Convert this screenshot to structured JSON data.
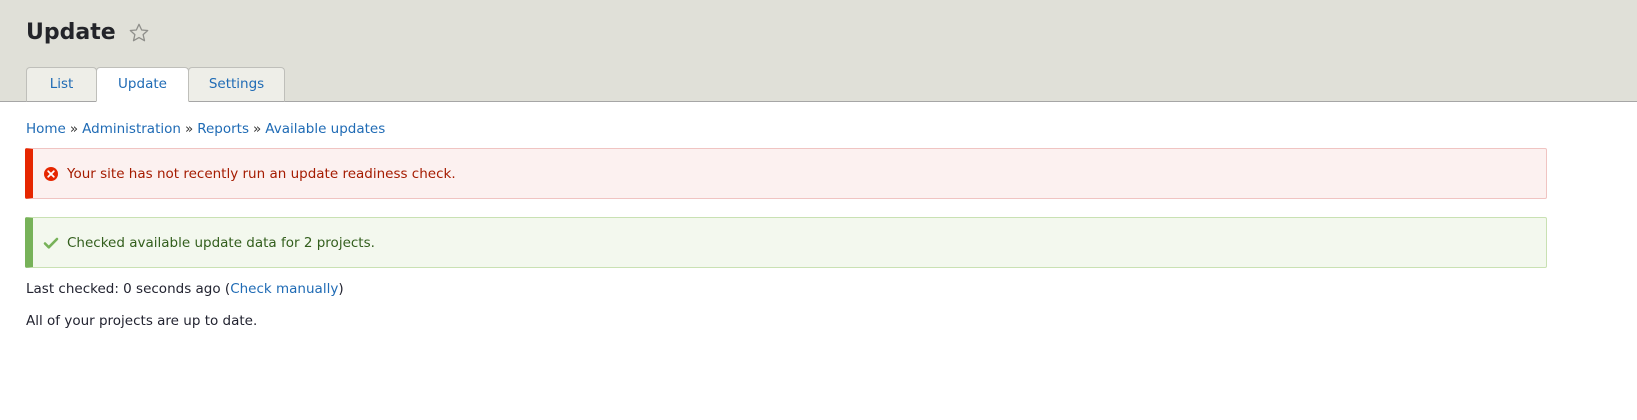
{
  "header": {
    "title": "Update",
    "star_icon": "star-outline-icon"
  },
  "tabs": [
    {
      "label": "List",
      "active": false
    },
    {
      "label": "Update",
      "active": true
    },
    {
      "label": "Settings",
      "active": false
    }
  ],
  "breadcrumb": {
    "items": [
      "Home",
      "Administration",
      "Reports",
      "Available updates"
    ],
    "separator": "»"
  },
  "messages": {
    "error": {
      "text": "Your site has not recently run an update readiness check.",
      "icon": "error-circle-icon",
      "color": "#e62600"
    },
    "status": {
      "text": "Checked available update data for 2 projects.",
      "icon": "checkmark-icon",
      "color": "#77b259"
    }
  },
  "last_checked": {
    "prefix": "Last checked: 0 seconds ago (",
    "link": "Check manually",
    "suffix": ")"
  },
  "summary": "All of your projects are up to date.",
  "colors": {
    "link": "#1f6bb5",
    "header_bg": "#e0e0d8"
  }
}
